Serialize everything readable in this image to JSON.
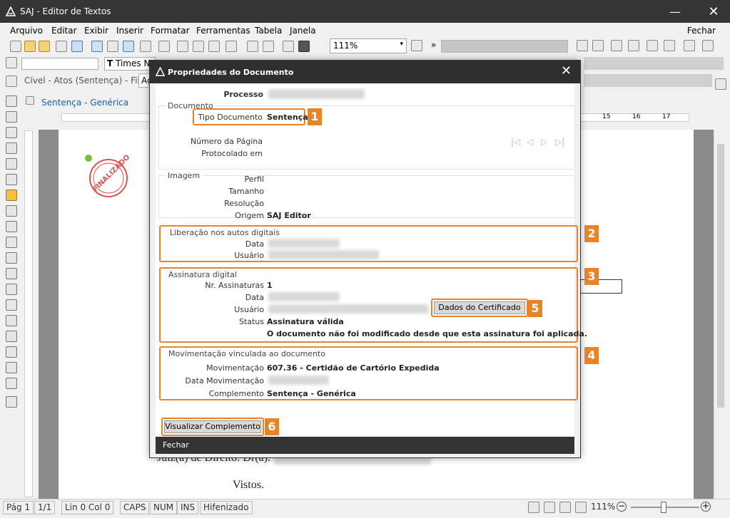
{
  "app": {
    "title": "SAJ - Editor de Textos"
  },
  "menu": [
    "Arquivo",
    "Editar",
    "Exibir",
    "Inserir",
    "Formatar",
    "Ferramentas",
    "Tabela",
    "Janela"
  ],
  "menu_close": "Fechar",
  "toolbar": {
    "zoom": "111%",
    "font": "Times New Roman",
    "crumb": "Cível - Atos (Sentença) - Fila:",
    "fila": "Ag"
  },
  "doc_tab": {
    "label": "Sentença - Genérica"
  },
  "ruler": {
    "right_marks": [
      "15",
      "16",
      "17"
    ]
  },
  "document": {
    "stamp": "FINALIZADO",
    "line1": "Juiz(a) de Direito: Dr(a).",
    "line2": "Vistos."
  },
  "dialog": {
    "title": "Propriedades do Documento",
    "processo_label": "Processo",
    "documento": {
      "section": "Documento",
      "tipo_label": "Tipo Documento",
      "tipo_value": "Sentenças",
      "pagina_label": "Número da Página",
      "protocolado_label": "Protocolado em"
    },
    "imagem": {
      "section": "Imagem",
      "perfil_label": "Perfil",
      "tamanho_label": "Tamanho",
      "resolucao_label": "Resolução",
      "origem_label": "Origem",
      "origem_value": "SAJ Editor"
    },
    "liberacao": {
      "section": "Liberação nos autos digitais",
      "data_label": "Data",
      "usuario_label": "Usuário"
    },
    "assinatura": {
      "section": "Assinatura digital",
      "nr_label": "Nr. Assinaturas",
      "nr_value": "1",
      "data_label": "Data",
      "usuario_label": "Usuário",
      "status_label": "Status",
      "status_value": "Assinatura válida",
      "message": "O documento não foi modificado desde que esta assinatura foi aplicada.",
      "cert_button": "Dados do Certificado"
    },
    "movimentacao": {
      "section": "Movimentação vinculada ao documento",
      "mov_label": "Movimentação",
      "mov_value": "607.36 - Certidão de Cartório Expedida",
      "data_label": "Data Movimentação",
      "comp_label": "Complemento",
      "comp_value": "Sentença - Genérica"
    },
    "visualizar_button": "Visualizar Complemento",
    "footer_close": "Fechar",
    "badges": [
      "1",
      "2",
      "3",
      "4",
      "5",
      "6"
    ]
  },
  "status": {
    "page": "Pág 1",
    "pages": "1/1",
    "pos": "Lin 0  Col 0",
    "caps": "CAPS",
    "num": "NUM",
    "ins": "INS",
    "hyph": "Hifenizado",
    "zoom": "111%"
  },
  "colors": {
    "highlight": "#e98326",
    "titlebar": "#353535",
    "accent": "#1a5fa8"
  }
}
